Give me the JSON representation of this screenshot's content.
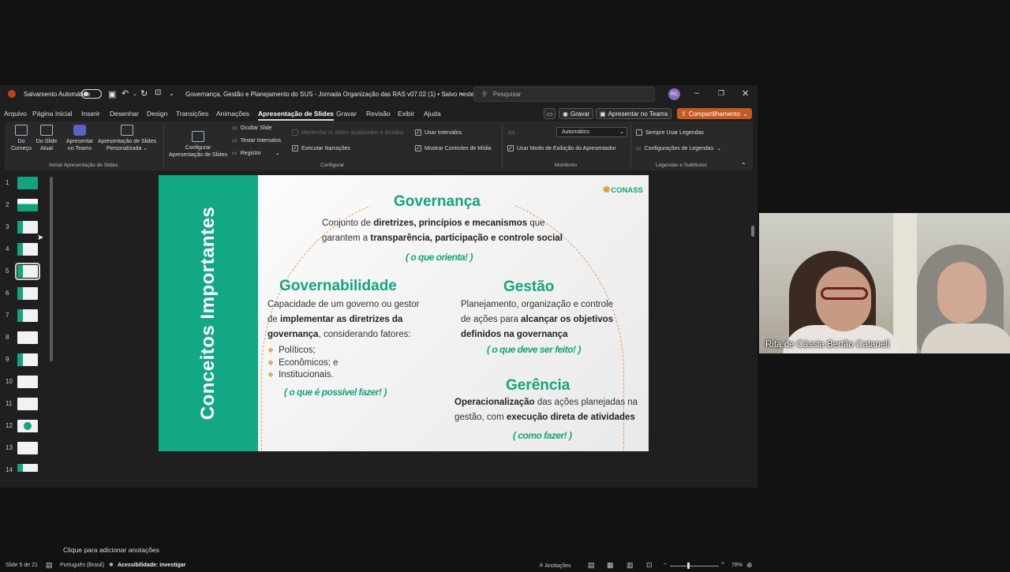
{
  "titlebar": {
    "autosave_label": "Salvamento Automático",
    "doc_title": "Governança, Gestão e Planejamento do SUS - Jornada Organização das RAS v07.02 (1) • Salvo neste PC",
    "search_placeholder": "Pesquisar",
    "avatar_initials": "RC"
  },
  "menu": {
    "tabs": [
      "Arquivo",
      "Página Inicial",
      "Inserir",
      "Desenhar",
      "Design",
      "Transições",
      "Animações",
      "Apresentação de Slides",
      "Gravar",
      "Revisão",
      "Exibir",
      "Ajuda"
    ],
    "active_tab": "Apresentação de Slides",
    "record_label": "Gravar",
    "teams_label": "Apresentar no Teams",
    "share_label": "Compartilhamento"
  },
  "ribbon": {
    "from_beginning": [
      "Do",
      "Começo"
    ],
    "from_current": [
      "Do Slide",
      "Atual"
    ],
    "present_teams": [
      "Apresentar",
      "no Teams"
    ],
    "custom_show": [
      "Apresentação de Slides",
      "Personalizada"
    ],
    "group_start": "Iniciar Apresentação de Slides",
    "setup_show": [
      "Configurar",
      "Apresentação de Slides"
    ],
    "hide_slide": "Ocultar Slide",
    "rehearse": "Testar Intervalos",
    "record": "Registro",
    "keep_updated": "Mantenha os slides atualizados e dicados",
    "play_narrations": "Executar Narrações",
    "use_timings": "Usar Intervalos",
    "show_media_controls": "Mostrar Controles de Mídia",
    "group_setup": "Configurar",
    "monitor_value": "Automático",
    "presenter_view": "Usar Modo de Exibição do Apresentador",
    "group_monitors": "Monitores",
    "always_captions": "Sempre Usar Legendas",
    "caption_settings": "Configurações de Legendas",
    "group_captions": "Legendas e Subtítulos"
  },
  "thumbnails": [
    "1",
    "2",
    "3",
    "4",
    "5",
    "6",
    "7",
    "8",
    "9",
    "10",
    "11",
    "12",
    "13",
    "14"
  ],
  "slide": {
    "vertical_title": "Conceitos Importantes",
    "logo": "CONASS",
    "governanca_title": "Governança",
    "governanca_line1_pre": "Conjunto de ",
    "governanca_line1_bold": "diretrizes, princípios e mecanismos",
    "governanca_line1_post": " que",
    "governanca_line2_pre": "garantem a ",
    "governanca_line2_bold": "transparência, participação e controle social",
    "governanca_tag": "( o que orienta! )",
    "governabilidade_title": "Governabilidade",
    "governabilidade_line1": "Capacidade de um governo ou gestor",
    "governabilidade_line2_pre": "de ",
    "governabilidade_line2_bold": "implementar as diretrizes da",
    "governabilidade_line3_bold": "governança",
    "governabilidade_line3_post": ", considerando fatores:",
    "bullets": [
      "Políticos;",
      "Econômicos; e",
      "Institucionais."
    ],
    "governabilidade_tag": "( o que é possível fazer! )",
    "gestao_title": "Gestão",
    "gestao_line1": "Planejamento, organização e controle",
    "gestao_line2_pre": "de ações para ",
    "gestao_line2_bold": "alcançar os objetivos",
    "gestao_line3_bold": "definidos na governança",
    "gestao_tag": "( o que deve ser feito! )",
    "gerencia_title": "Gerência",
    "gerencia_line1_bold": "Operacionalização",
    "gerencia_line1_post": " das ações planejadas na",
    "gerencia_line2_pre": "gestão, com ",
    "gerencia_line2_bold": "execução direta de atividades",
    "gerencia_tag": "( como fazer! )"
  },
  "notes_placeholder": "Clique para adicionar anotações",
  "status": {
    "slide_info": "Slide 5 de 21",
    "language": "Português (Brasil)",
    "accessibility": "Acessibilidade: investigar",
    "notes_btn": "Anotações",
    "zoom": "78%"
  },
  "video": {
    "participant_name": "Rita de Cássia Bertão Cataneli"
  }
}
